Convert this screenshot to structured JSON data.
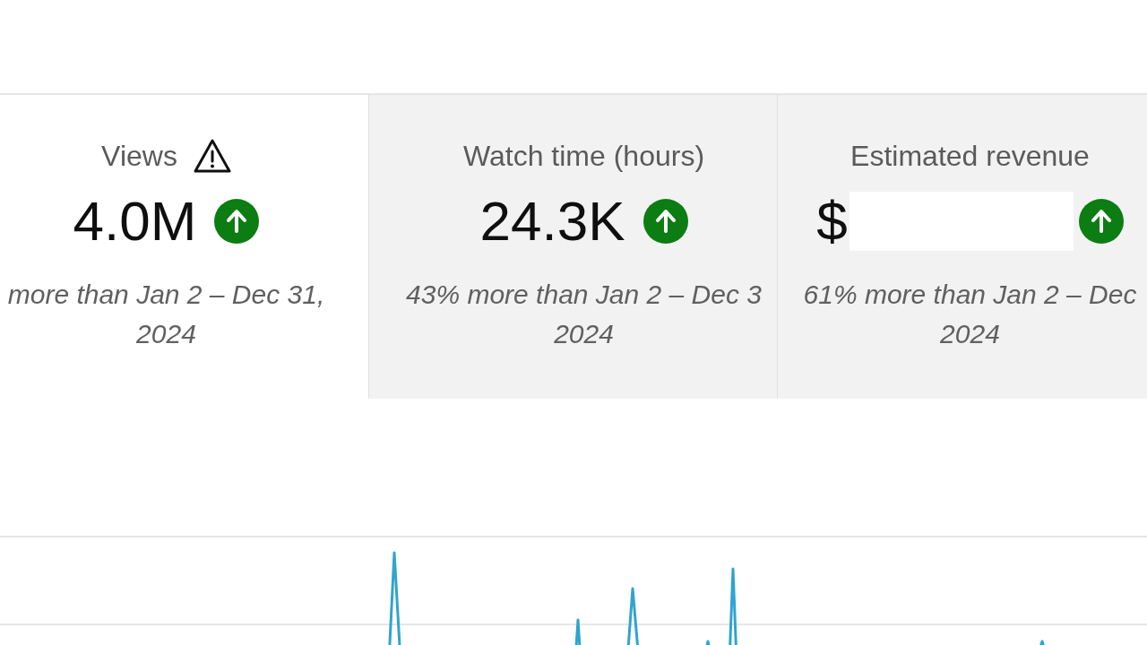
{
  "metrics": [
    {
      "title": "Views",
      "warning": true,
      "value": "4.0M",
      "redacted": false,
      "rising": true,
      "comparison": [
        "more than Jan 2 – Dec 31,",
        "2024"
      ],
      "selected": true
    },
    {
      "title": "Watch time (hours)",
      "warning": false,
      "value": "24.3K",
      "redacted": false,
      "rising": true,
      "comparison": [
        "43% more than Jan 2 – Dec 3",
        "2024"
      ],
      "selected": false
    },
    {
      "title": "Estimated revenue",
      "warning": false,
      "value": "$",
      "redacted": true,
      "rising": true,
      "comparison": [
        "61% more than Jan 2 – Dec",
        "2024"
      ],
      "selected": false
    }
  ]
}
